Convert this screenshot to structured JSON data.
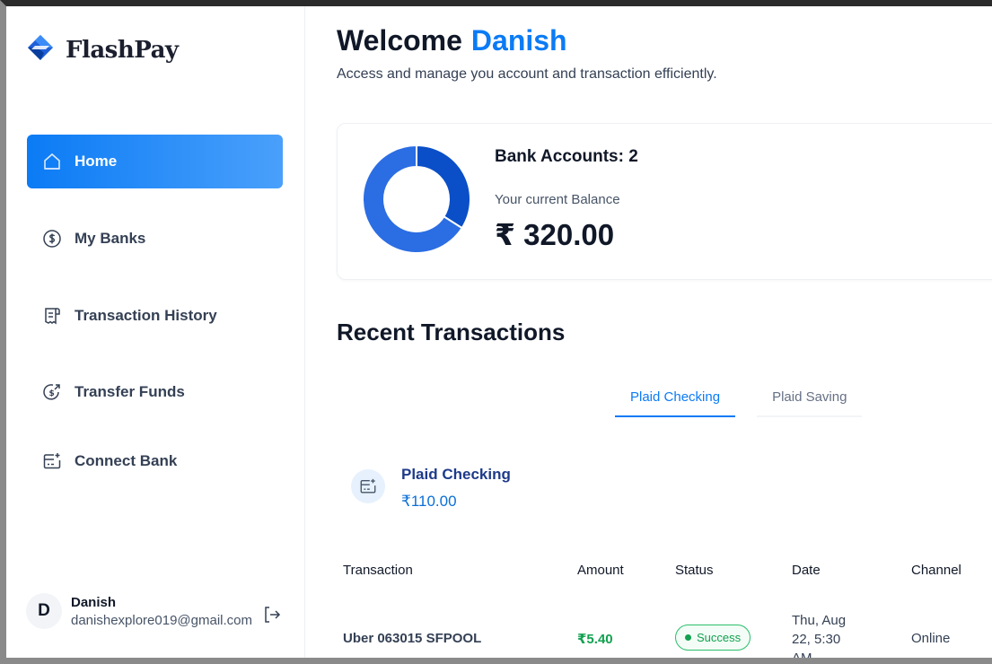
{
  "sidebar": {
    "logo_text": "FlashPay",
    "items": [
      {
        "label": "Home",
        "icon": "home-icon",
        "active": true
      },
      {
        "label": "My Banks",
        "icon": "dollar-circle-icon",
        "active": false
      },
      {
        "label": "Transaction History",
        "icon": "receipt-icon",
        "active": false
      },
      {
        "label": "Transfer Funds",
        "icon": "money-send-icon",
        "active": false
      },
      {
        "label": "Connect Bank",
        "icon": "card-add-icon",
        "active": false
      }
    ],
    "user": {
      "initial": "D",
      "name": "Danish",
      "email": "danishexplore019@gmail.com",
      "logout_icon": "logout-icon"
    }
  },
  "header": {
    "welcome": "Welcome",
    "user_name": "Danish",
    "subtitle": "Access and manage you account and transaction efficiently."
  },
  "balance": {
    "accounts_label": "Bank Accounts: 2",
    "current_balance_label": "Your current Balance",
    "current_balance": "₹ 320.00",
    "donut_shares": [
      0.34,
      0.66
    ],
    "donut_colors": [
      "#0a4fc7",
      "#2b6de3"
    ]
  },
  "recent": {
    "title": "Recent Transactions",
    "tabs": [
      {
        "label": "Plaid Checking",
        "active": true
      },
      {
        "label": "Plaid Saving",
        "active": false
      }
    ],
    "account": {
      "name": "Plaid Checking",
      "balance": "₹110.00"
    },
    "columns": [
      "Transaction",
      "Amount",
      "Status",
      "Date",
      "Channel"
    ],
    "rows": [
      {
        "transaction": "Uber 063015 SFPOOL",
        "amount": "₹5.40",
        "status": "Success",
        "date_line1": "Thu, Aug",
        "date_line2": "22, 5:30",
        "date_line3": "AM",
        "channel": "Online"
      }
    ]
  },
  "colors": {
    "accent": "#0b7bf5",
    "success": "#12a150"
  }
}
